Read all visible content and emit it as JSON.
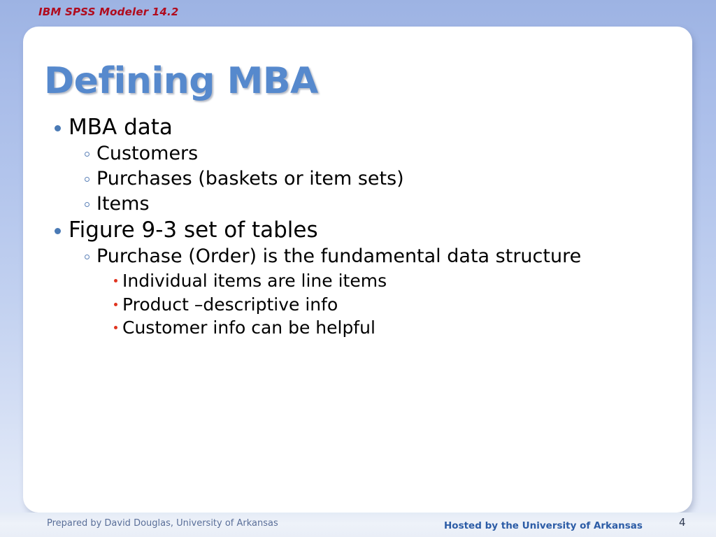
{
  "header": {
    "brand": "IBM SPSS Modeler 14.2"
  },
  "slide": {
    "title": "Defining MBA",
    "bullets": [
      {
        "level": 1,
        "text": "MBA data",
        "marker": "filled-blue-dot"
      },
      {
        "level": 2,
        "text": "Customers",
        "marker": "hollow-blue-circle"
      },
      {
        "level": 2,
        "text": "Purchases (baskets or item sets)",
        "marker": "hollow-blue-circle"
      },
      {
        "level": 2,
        "text": "Items",
        "marker": "hollow-blue-circle"
      },
      {
        "level": 1,
        "text": "Figure 9-3 set of tables",
        "marker": "filled-blue-dot"
      },
      {
        "level": 2,
        "text": "Purchase (Order) is the fundamental data structure",
        "marker": "hollow-blue-circle"
      },
      {
        "level": 3,
        "text": "Individual items are line items",
        "marker": "small-red-dot"
      },
      {
        "level": 3,
        "text": "Product –descriptive info",
        "marker": "small-red-dot"
      },
      {
        "level": 3,
        "text": "Customer info can be helpful",
        "marker": "small-red-dot"
      }
    ]
  },
  "footer": {
    "left": "Prepared by David Douglas, University of Arkansas",
    "center": "Hosted by the University of Arkansas",
    "slide_number": "4"
  },
  "colors": {
    "brand_red": "#b00b1d",
    "title_blue": "#5689cd",
    "bullet_blue": "#4a7ab5",
    "bullet_red": "#e0341f",
    "footer_left_text": "#5a6f99",
    "footer_center_text": "#2c5ca6",
    "background_top": "#9db3e3",
    "background_bottom": "#e7edf9",
    "card": "#ffffff"
  }
}
